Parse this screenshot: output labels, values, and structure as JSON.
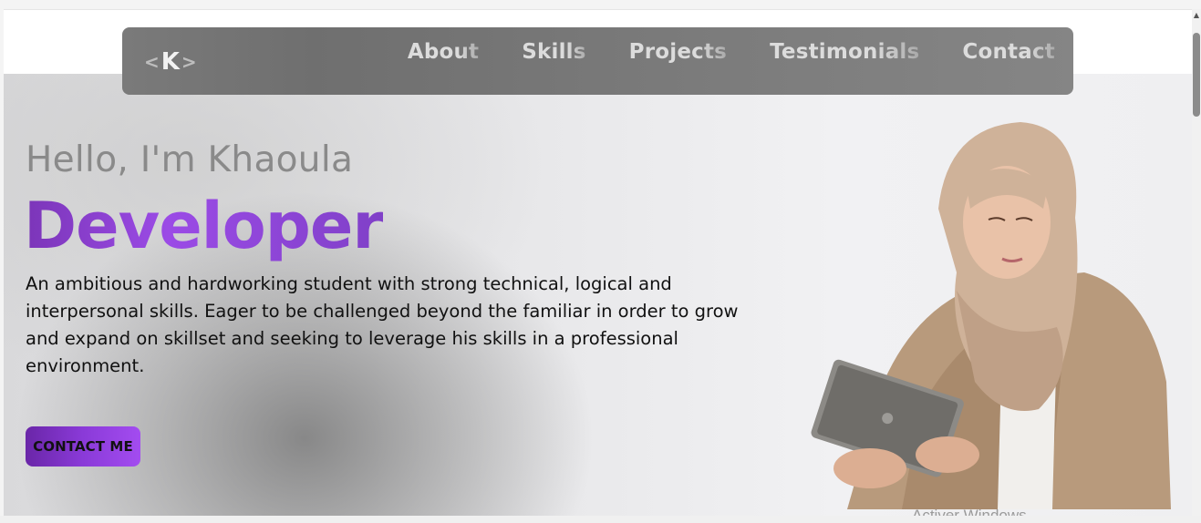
{
  "navbar": {
    "logo": {
      "left": "<",
      "letter": "K",
      "right": ">"
    },
    "links": [
      "About",
      "Skills",
      "Projects",
      "Testimonials",
      "Contact"
    ]
  },
  "hero": {
    "greeting": "Hello, I'm Khaoula",
    "role": "Developer",
    "bio": "An ambitious and hardworking student with strong technical, logical and interpersonal skills. Eager to be challenged beyond the familiar in order to grow and expand on skillset and seeking to leverage his skills in a professional environment.",
    "cta_label": "CONTACT ME"
  },
  "os_overlay": {
    "watermark": "Activer Windows"
  },
  "colors": {
    "accent_start": "#6a26a8",
    "accent_end": "#a34cf0",
    "navbar_bg": "#777777"
  }
}
